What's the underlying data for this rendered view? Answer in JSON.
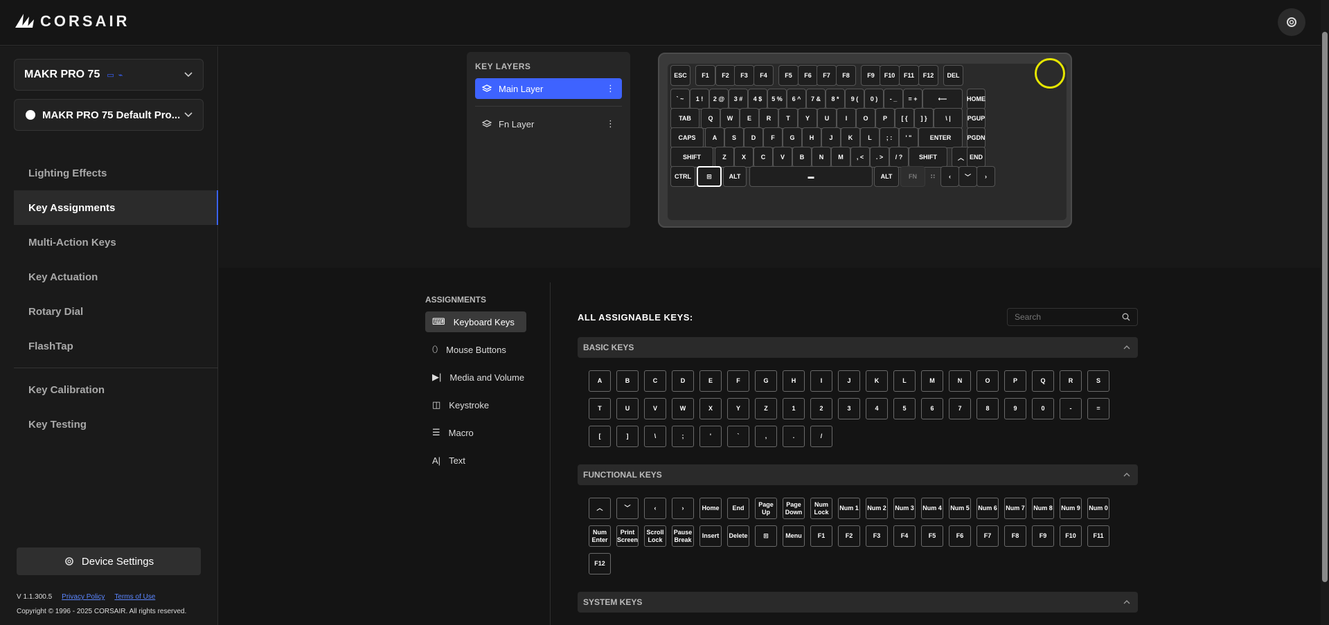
{
  "brand": "CORSAIR",
  "device": {
    "name": "MAKR PRO 75",
    "profile": "MAKR PRO 75 Default Pro..."
  },
  "nav": {
    "items": [
      {
        "label": "Lighting Effects"
      },
      {
        "label": "Key Assignments",
        "active": true
      },
      {
        "label": "Multi-Action Keys"
      },
      {
        "label": "Key Actuation"
      },
      {
        "label": "Rotary Dial"
      },
      {
        "label": "FlashTap"
      }
    ],
    "items2": [
      {
        "label": "Key Calibration"
      },
      {
        "label": "Key Testing"
      }
    ]
  },
  "device_settings": "Device Settings",
  "footer": {
    "version": "V 1.1.300.5",
    "privacy": "Privacy Policy",
    "terms": "Terms of Use",
    "copyright": "Copyright © 1996 - 2025 CORSAIR. All rights reserved."
  },
  "layers": {
    "title": "KEY LAYERS",
    "items": [
      {
        "label": "Main Layer",
        "active": true
      },
      {
        "label": "Fn Layer"
      }
    ]
  },
  "keyboard": {
    "row1": [
      "ESC",
      "F1",
      "F2",
      "F3",
      "F4",
      "F5",
      "F6",
      "F7",
      "F8",
      "F9",
      "F10",
      "F11",
      "F12",
      "DEL"
    ],
    "row2": [
      "` ~",
      "1 !",
      "2 @",
      "3 #",
      "4 $",
      "5 %",
      "6 ^",
      "7 &",
      "8 *",
      "9 (",
      "0 )",
      "- _",
      "= +",
      "⟵",
      "HOME"
    ],
    "row3": [
      "TAB",
      "Q",
      "W",
      "E",
      "R",
      "T",
      "Y",
      "U",
      "I",
      "O",
      "P",
      "[ {",
      "] }",
      "\\ |",
      "PGUP"
    ],
    "row4": [
      "CAPS",
      "A",
      "S",
      "D",
      "F",
      "G",
      "H",
      "J",
      "K",
      "L",
      "; :",
      "' \"",
      "ENTER",
      "PGDN"
    ],
    "row5": [
      "SHIFT",
      "Z",
      "X",
      "C",
      "V",
      "B",
      "N",
      "M",
      ", <",
      ". >",
      "/ ?",
      "SHIFT",
      "︿",
      "END"
    ],
    "row6": [
      "CTRL",
      "⊞",
      "ALT",
      "▬",
      "ALT",
      "FN",
      "∷",
      "‹",
      "﹀",
      "›"
    ]
  },
  "assignments": {
    "title": "ASSIGNMENTS",
    "items": [
      {
        "label": "Keyboard Keys",
        "icon": "keyboard-icon",
        "active": true
      },
      {
        "label": "Mouse Buttons",
        "icon": "mouse-icon"
      },
      {
        "label": "Media and Volume",
        "icon": "media-icon"
      },
      {
        "label": "Keystroke",
        "icon": "keystroke-icon"
      },
      {
        "label": "Macro",
        "icon": "macro-icon"
      },
      {
        "label": "Text",
        "icon": "text-icon"
      }
    ]
  },
  "all_keys_title": "ALL ASSIGNABLE KEYS:",
  "search": {
    "placeholder": "Search"
  },
  "sections": {
    "basic": {
      "title": "BASIC KEYS",
      "keys": [
        "A",
        "B",
        "C",
        "D",
        "E",
        "F",
        "G",
        "H",
        "I",
        "J",
        "K",
        "L",
        "M",
        "N",
        "O",
        "P",
        "Q",
        "R",
        "S",
        "T",
        "U",
        "V",
        "W",
        "X",
        "Y",
        "Z",
        "1",
        "2",
        "3",
        "4",
        "5",
        "6",
        "7",
        "8",
        "9",
        "0",
        "-",
        "=",
        "[",
        "]",
        "\\",
        ";",
        "'",
        "`",
        ",",
        ".",
        "/"
      ]
    },
    "functional": {
      "title": "FUNCTIONAL KEYS",
      "keys": [
        "︿",
        "﹀",
        "‹",
        "›",
        "Home",
        "End",
        "Page Up",
        "Page Down",
        "Num Lock",
        "Num 1",
        "Num 2",
        "Num 3",
        "Num 4",
        "Num 5",
        "Num 6",
        "Num 7",
        "Num 8",
        "Num 9",
        "Num 0",
        "Num Enter",
        "Print Screen",
        "Scroll Lock",
        "Pause Break",
        "Insert",
        "Delete",
        "⊞",
        "Menu",
        "F1",
        "F2",
        "F3",
        "F4",
        "F5",
        "F6",
        "F7",
        "F8",
        "F9",
        "F10",
        "F11",
        "F12"
      ]
    },
    "system": {
      "title": "SYSTEM KEYS"
    }
  },
  "colors": {
    "accent": "#3e63ff",
    "dial": "#e6e600"
  }
}
